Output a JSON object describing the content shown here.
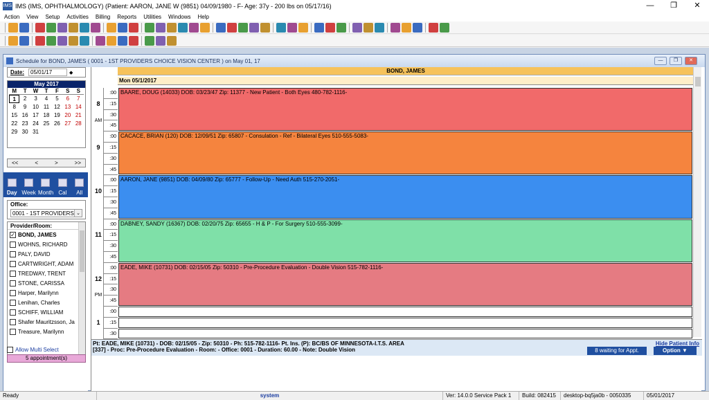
{
  "window": {
    "title": "IMS (IMS, OPHTHALMOLOGY)    (Patient: AARON, JANE W (9851) 04/09/1980 - F- Age: 37y  - 200 lbs on 05/17/16)"
  },
  "menu": [
    "Action",
    "View",
    "Setup",
    "Activities",
    "Billing",
    "Reports",
    "Utilities",
    "Windows",
    "Help"
  ],
  "child": {
    "title": "Schedule for BOND, JAMES ( 0001 - 1ST PROVIDERS CHOICE VISION CENTER )  on  May 01, 17"
  },
  "datepicker": {
    "label": "Date:",
    "value": "05/01/17"
  },
  "calendar": {
    "month": "May 2017",
    "dow": [
      "M",
      "T",
      "W",
      "T",
      "F",
      "S",
      "S"
    ],
    "weeks": [
      [
        "1",
        "2",
        "3",
        "4",
        "5",
        "6",
        "7"
      ],
      [
        "8",
        "9",
        "10",
        "11",
        "12",
        "13",
        "14"
      ],
      [
        "15",
        "16",
        "17",
        "18",
        "19",
        "20",
        "21"
      ],
      [
        "22",
        "23",
        "24",
        "25",
        "26",
        "27",
        "28"
      ],
      [
        "29",
        "30",
        "31",
        "",
        "",
        "",
        ""
      ]
    ],
    "nav": [
      "<<",
      "<",
      ">",
      ">>"
    ]
  },
  "views": [
    "Day",
    "Week",
    "Month",
    "Cal",
    "All"
  ],
  "office": {
    "label": "Office:",
    "value": "0001 - 1ST PROVIDERS"
  },
  "providers": {
    "header": "Provider/Room:",
    "items": [
      {
        "name": "BOND, JAMES",
        "checked": true
      },
      {
        "name": "WOHNS, RICHARD",
        "checked": false
      },
      {
        "name": "PALY, DAVID",
        "checked": false
      },
      {
        "name": "CARTWRIGHT, ADAM",
        "checked": false
      },
      {
        "name": "TREDWAY, TRENT",
        "checked": false
      },
      {
        "name": "STONE, CARISSA",
        "checked": false
      },
      {
        "name": "Harper, Marilynn",
        "checked": false
      },
      {
        "name": "Lenihan, Charles",
        "checked": false
      },
      {
        "name": "SCHIFF, WILLIAM",
        "checked": false
      },
      {
        "name": "Shafer Mauritzsson, Ja",
        "checked": false
      },
      {
        "name": "Treasure, Marilynn",
        "checked": false
      }
    ]
  },
  "multi_select": "Allow Multi Select",
  "appt_count": "5 appointment(s)",
  "schedule": {
    "provider": "BOND, JAMES",
    "date": "Mon 05/1/2017",
    "hours": [
      {
        "hour": "8",
        "ampm": "AM"
      },
      {
        "hour": "9",
        "ampm": ""
      },
      {
        "hour": "10",
        "ampm": ""
      },
      {
        "hour": "11",
        "ampm": ""
      },
      {
        "hour": "12",
        "ampm": "PM"
      },
      {
        "hour": "1",
        "ampm": ""
      }
    ],
    "slots": [
      ":00",
      ":15",
      ":30",
      ":45"
    ],
    "appointments": [
      {
        "text": "BAARE, DOUG  (14033)  DOB: 03/23/47  Zip: 11377 -  New Patient - Both Eyes     480-782-1116-",
        "color": "#f16a6a"
      },
      {
        "text": "CACACE, BRIAN  (120)  DOB: 12/09/51  Zip: 65807 -  Consulation - Ref - Bilateral Eyes     510-555-5083-",
        "color": "#f5843e"
      },
      {
        "text": "AARON, JANE  (9851)  DOB: 04/09/80  Zip: 65777 -  Follow-Up - Need Auth     515-270-2051-",
        "color": "#3b8ef0"
      },
      {
        "text": "DABNEY, SANDY  (16367)  DOB: 02/20/75  Zip: 65655 -  H & P - For Surgery     510-555-3099-",
        "color": "#7fe0a8"
      },
      {
        "text": "EADE, MIKE  (10731)  DOB: 02/15/05  Zip: 50310 -  Pre-Procedure Evaluation - Double Vision     515-782-1116-",
        "color": "#e57b82"
      }
    ]
  },
  "info": {
    "line1": "Pt: EADE, MIKE  (10731) - DOB: 02/15/05 - Zip: 50310 - Ph: 515-782-1116- Pt. Ins. (P): BC/BS OF MINNESOTA-I.T.S. AREA",
    "line2": "[337]  - Proc: Pre-Procedure Evaluation - Room:    - Office: 0001  - Duration: 60.00 - Note:  Double Vision",
    "hide_link": "Hide Patient Info",
    "waiting": "8 waiting for Appt.",
    "option": "Option ▼"
  },
  "status": {
    "ready": "Ready",
    "user": "system",
    "version": "Ver: 14.0.0 Service Pack 1",
    "build": "Build: 082415",
    "host": "desktop-bq5ja0b - 0050335",
    "date": "05/01/2017"
  }
}
